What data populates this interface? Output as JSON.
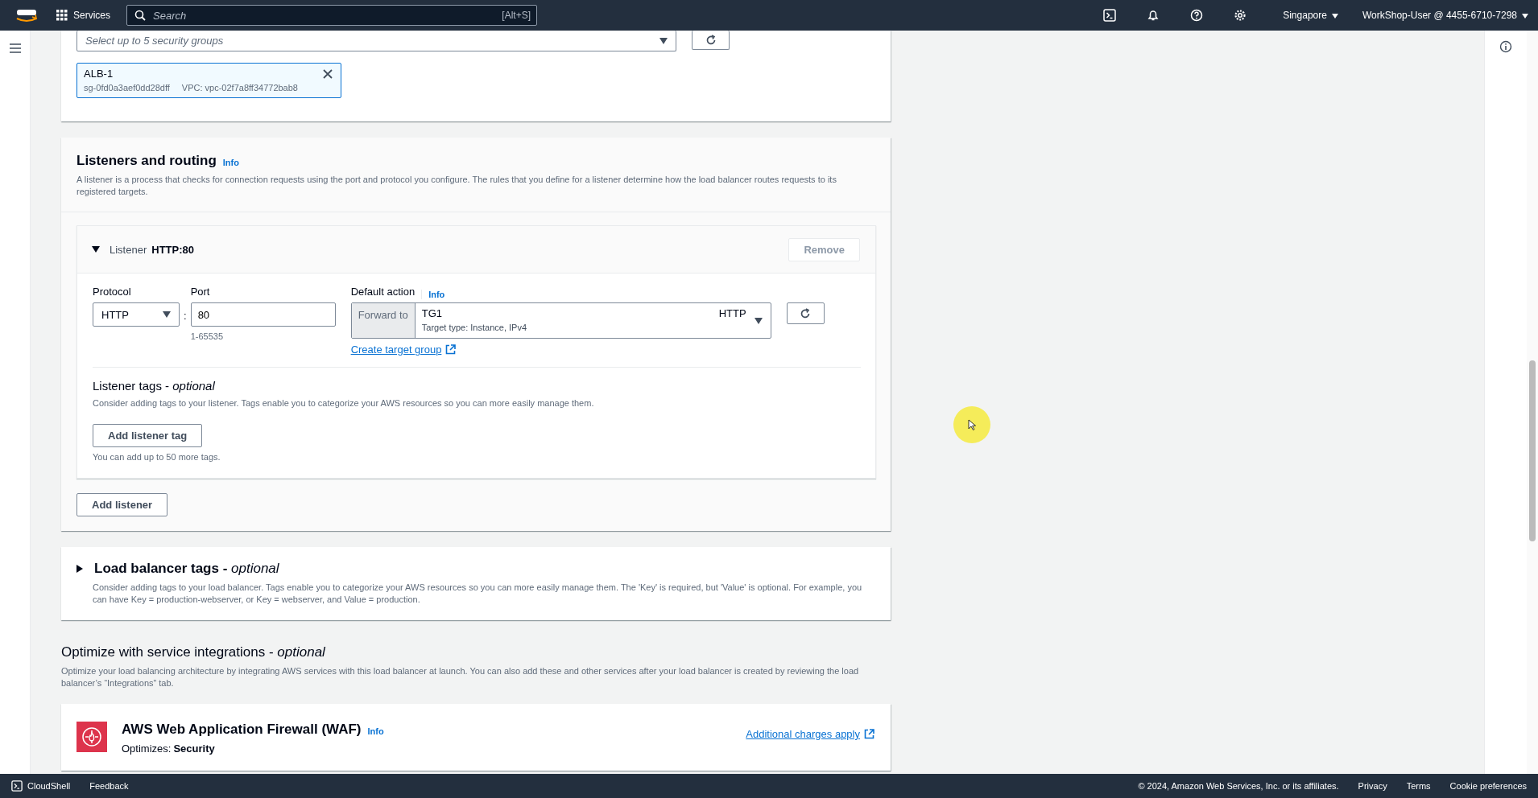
{
  "top_nav": {
    "services": "Services",
    "search": {
      "placeholder": "Search"
    },
    "shortcut": "[Alt+S]",
    "region": "Singapore",
    "account": "WorkShop-User @ 4455-6710-7298"
  },
  "security_groups": {
    "placeholder": "Select up to 5 security groups",
    "chips": [
      {
        "name": "ALB-1",
        "id": "sg-0fd0a3aef0dd28dff",
        "vpc": "VPC: vpc-02f7a8ff34772bab8"
      }
    ]
  },
  "listeners_routing": {
    "title": "Listeners and routing",
    "info": "Info",
    "description": "A listener is a process that checks for connection requests using the port and protocol you configure. The rules that you define for a listener determine how the load balancer routes requests to its registered targets.",
    "listeners": [
      {
        "label": "Listener",
        "name": "HTTP:80",
        "expanded": true,
        "remove": {
          "label": "Remove",
          "disabled": true
        },
        "protocol": {
          "label": "Protocol",
          "value": "HTTP"
        },
        "separator": ":",
        "port": {
          "label": "Port",
          "value": "80",
          "hint": "1-65535"
        },
        "default_action": {
          "label": "Default action",
          "info": "Info",
          "prefix": "Forward to",
          "target": "TG1",
          "target_protocol": "HTTP",
          "target_detail": "Target type: Instance, IPv4",
          "create_link": "Create target group"
        },
        "tags": {
          "title": "Listener tags - *optional*",
          "description": "Consider adding tags to your listener. Tags enable you to categorize your AWS resources so you can more easily manage them.",
          "button": "Add listener tag",
          "hint": "You can add up to 50 more tags."
        }
      }
    ],
    "add_button": "Add listener"
  },
  "load_balancer_tags": {
    "title": "Load balancer tags - *optional*",
    "expanded": false,
    "description": "Consider adding tags to your load balancer. Tags enable you to categorize your AWS resources so you can more easily manage them. The 'Key' is required, but 'Value' is optional. For example, you can have Key = production-webserver, or Key = webserver, and Value = production."
  },
  "integrations": {
    "title": "Optimize with service integrations - *optional*",
    "description": "Optimize your load balancing architecture by integrating AWS services with this load balancer at launch. You can also add these and other services after your load balancer is created by reviewing the load balancer’s “Integrations” tab.",
    "services": [
      {
        "name": "AWS Web Application Firewall (WAF)",
        "info": "Info",
        "optimizes_label": "Optimizes:",
        "optimizes": "Security",
        "link": "Additional charges apply"
      }
    ]
  },
  "footer": {
    "cloudshell": "CloudShell",
    "feedback": "Feedback",
    "copyright": "© 2024, Amazon Web Services, Inc. or its affiliates.",
    "links": [
      "Privacy",
      "Terms",
      "Cookie preferences"
    ]
  }
}
